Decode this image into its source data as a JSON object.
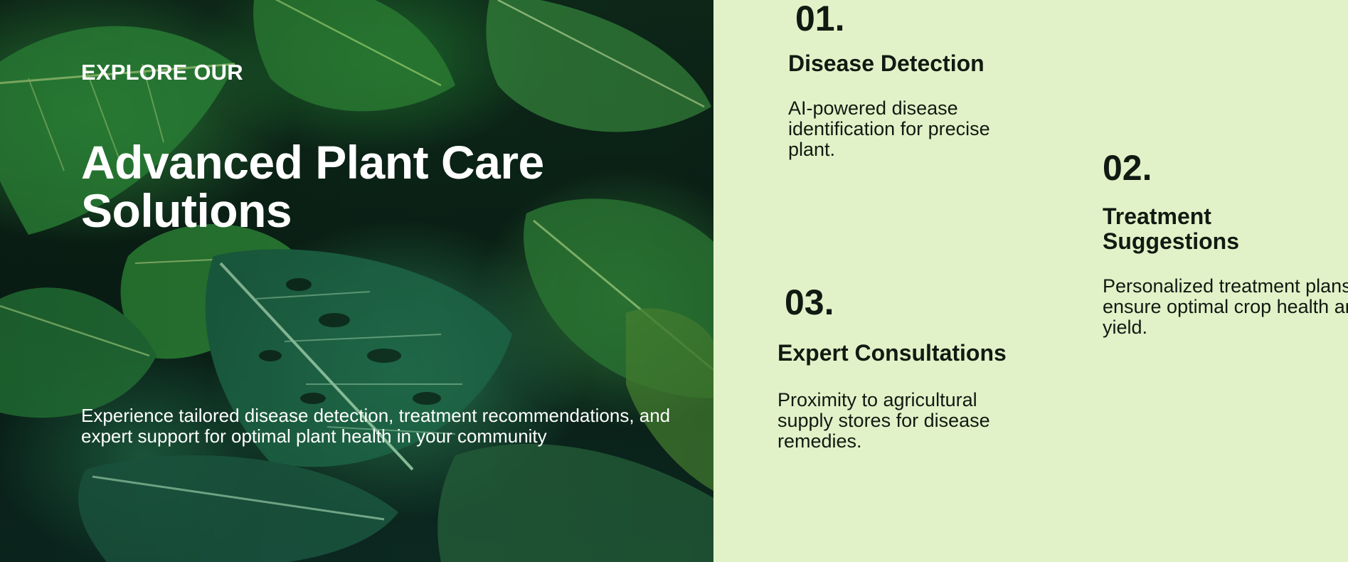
{
  "hero": {
    "eyebrow": "EXPLORE OUR",
    "title": "Advanced Plant Care Solutions",
    "description": "Experience tailored disease detection, treatment recommendations, and expert support for optimal plant health in your community"
  },
  "features": [
    {
      "number": "01.",
      "title": "Disease Detection",
      "description": "AI-powered disease identification for precise plant."
    },
    {
      "number": "02.",
      "title": "Treatment Suggestions",
      "description": "Personalized treatment plans to ensure optimal crop health and yield."
    },
    {
      "number": "03.",
      "title": "Expert Consultations",
      "description": "Proximity to agricultural supply stores for disease remedies."
    }
  ],
  "colors": {
    "panel_background": "#e2f2c8",
    "text_dark": "#111a12",
    "text_light": "#ffffff"
  }
}
